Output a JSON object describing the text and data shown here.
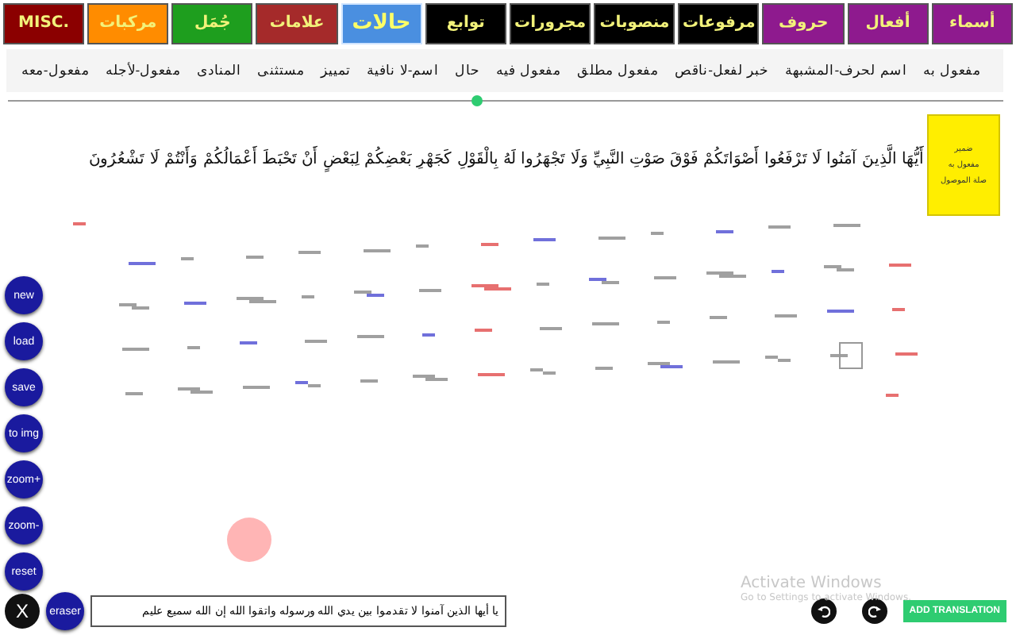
{
  "tabs": [
    {
      "label": "أسماء",
      "color": "#8e1a8e",
      "selected": false
    },
    {
      "label": "أفعال",
      "color": "#8e1a8e",
      "selected": false
    },
    {
      "label": "حروف",
      "color": "#8e1a8e",
      "selected": false
    },
    {
      "label": "مرفوعات",
      "color": "#000000",
      "selected": false
    },
    {
      "label": "منصوبات",
      "color": "#000000",
      "selected": false
    },
    {
      "label": "مجرورات",
      "color": "#000000",
      "selected": false
    },
    {
      "label": "توابع",
      "color": "#000000",
      "selected": false
    },
    {
      "label": "حالات",
      "color": "#4a8fe0",
      "selected": true
    },
    {
      "label": "علامات",
      "color": "#a52a2a",
      "selected": false
    },
    {
      "label": "جُمَل",
      "color": "#1e9e1e",
      "selected": false
    },
    {
      "label": "مركبات",
      "color": "#ff8c00",
      "selected": false
    },
    {
      "label": "MISC.",
      "color": "#8b0000",
      "selected": false
    }
  ],
  "subtabs": [
    "مفعول به",
    "اسم لحرف-المشبهة",
    "خبر لفعل-ناقص",
    "مفعول مطلق",
    "مفعول فيه",
    "حال",
    "اسم-لا نافية",
    "تمييز",
    "مستثنى",
    "المنادى",
    "مفعول-لأجله",
    "مفعول-معه"
  ],
  "zoom_slider": {
    "level": 0.47
  },
  "verse": "أَيُّهَا الَّذِينَ آمَنُوا لَا تَرْفَعُوا أَصْوَاتَكُمْ فَوْقَ صَوْتِ النَّبِيِّ وَلَا تَجْهَرُوا لَهُ بِالْقَوْلِ كَجَهْرِ بَعْضِكُمْ لِبَعْضٍ أَنْ تَحْبَطَ أَعْمَالُكُمْ وَأَنْتُمْ لَا تَشْعُرُونَ",
  "note": {
    "lines": [
      "ضمير",
      "مفعول به",
      "صلة الموصول"
    ]
  },
  "tools": [
    {
      "label": "new",
      "kind": "round"
    },
    {
      "label": "load",
      "kind": "round"
    },
    {
      "label": "save",
      "kind": "round"
    },
    {
      "label": "to img",
      "kind": "round"
    },
    {
      "label": "zoom+",
      "kind": "round"
    },
    {
      "label": "zoom-",
      "kind": "round"
    },
    {
      "label": "reset",
      "kind": "round"
    }
  ],
  "bottom_tools": [
    {
      "label": "eraser",
      "kind": "round"
    },
    {
      "label": "X",
      "kind": "close"
    }
  ],
  "input": {
    "value": "يا أيها الذين آمنوا لا تقدموا بين يدي الله ورسوله واتقوا الله إن الله سميع عليم"
  },
  "watermark": {
    "title": "Activate Windows",
    "subtitle": "Go to Settings to activate Windows."
  },
  "translate_button": "ADD TRANSLATION"
}
